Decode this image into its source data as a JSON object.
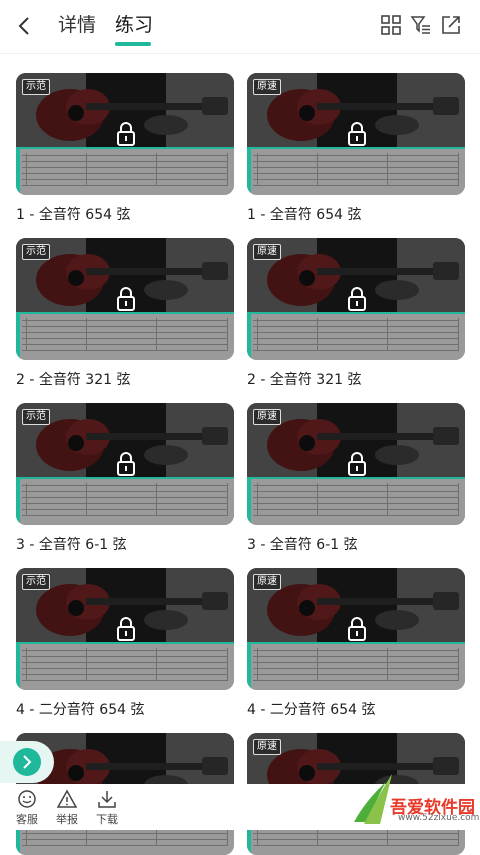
{
  "header": {
    "tabs": [
      {
        "label": "详情"
      },
      {
        "label": "练习"
      }
    ],
    "active_tab": "练习",
    "icons": [
      "grid-icon",
      "filter-icon",
      "share-icon"
    ]
  },
  "accent_color": "#1fb89b",
  "lessons": [
    {
      "tag": "示范",
      "title": "1 - 全音符 654 弦"
    },
    {
      "tag": "原速",
      "title": "1 - 全音符 654 弦"
    },
    {
      "tag": "示范",
      "title": "2 - 全音符 321 弦"
    },
    {
      "tag": "原速",
      "title": "2 - 全音符 321 弦"
    },
    {
      "tag": "示范",
      "title": "3 - 全音符 6-1 弦"
    },
    {
      "tag": "原速",
      "title": "3 - 全音符 6-1 弦"
    },
    {
      "tag": "示范",
      "title": "4 - 二分音符 654 弦"
    },
    {
      "tag": "原速",
      "title": "4 - 二分音符 654 弦"
    },
    {
      "tag": "",
      "title": ""
    },
    {
      "tag": "原速",
      "title": ""
    }
  ],
  "bottom_bar": {
    "items": [
      {
        "label": "客服"
      },
      {
        "label": "举报"
      },
      {
        "label": "下载"
      }
    ]
  },
  "watermark": {
    "name": "吾爱软件园",
    "url": "www.52zixue.com"
  }
}
